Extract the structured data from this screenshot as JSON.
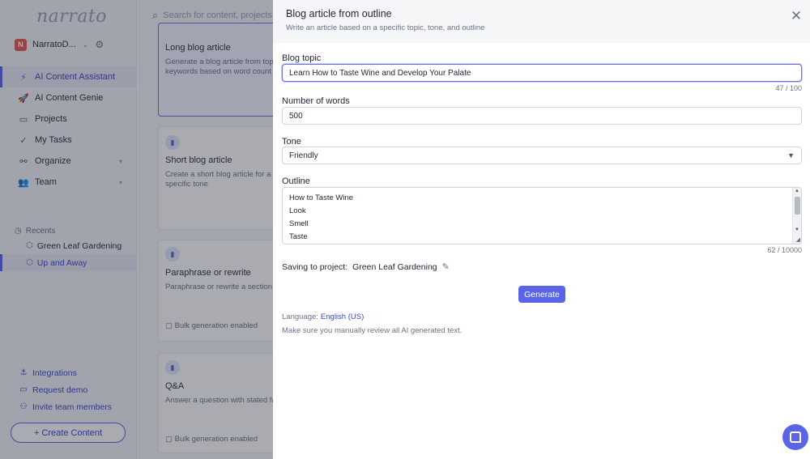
{
  "sidebar": {
    "logo": "narrato",
    "workspace": {
      "badge": "N",
      "name": "NarratoD..."
    },
    "nav": [
      {
        "label": "AI Content Assistant",
        "icon": "bolt-icon",
        "active": true
      },
      {
        "label": "AI Content Genie",
        "icon": "rocket-icon"
      },
      {
        "label": "Projects",
        "icon": "briefcase-icon"
      },
      {
        "label": "My Tasks",
        "icon": "check-icon"
      },
      {
        "label": "Organize",
        "icon": "organize-icon"
      },
      {
        "label": "Team",
        "icon": "team-icon"
      }
    ],
    "recents": {
      "heading": "Recents",
      "items": [
        {
          "label": "Green Leaf Gardening"
        },
        {
          "label": "Up and Away",
          "active": true
        }
      ]
    },
    "links": [
      {
        "label": "Integrations",
        "icon": "anchor-icon"
      },
      {
        "label": "Request demo",
        "icon": "monitor-icon"
      },
      {
        "label": "Invite team members",
        "icon": "user-plus-icon"
      }
    ],
    "create_button": "+ Create Content"
  },
  "main": {
    "search_placeholder": "Search for content, projects, a",
    "cards": [
      {
        "title": "Long blog article",
        "desc1": "Generate a blog article from topic",
        "desc2": "keywords based on word count a"
      },
      {
        "title": "Short blog article",
        "desc1": "Create a short blog article for a to",
        "desc2": "specific tone"
      },
      {
        "title": "Paraphrase or rewrite",
        "desc1": "Paraphrase or rewrite a section o",
        "bulk": "Bulk generation enabled"
      },
      {
        "title": "Q&A",
        "desc1": "Answer a question with stated fac",
        "bulk": "Bulk generation enabled"
      }
    ]
  },
  "drawer": {
    "title": "Blog article from outline",
    "subtitle": "Write an article based on a specific topic, tone, and outline",
    "topic": {
      "label": "Blog topic",
      "value": "Learn How to Taste Wine and Develop Your Palate",
      "counter": "47 / 100"
    },
    "words": {
      "label": "Number of words",
      "value": "500"
    },
    "tone": {
      "label": "Tone",
      "value": "Friendly"
    },
    "outline": {
      "label": "Outline",
      "lines": [
        "How to Taste Wine",
        "Look",
        "Smell",
        "Taste"
      ],
      "counter": "62 / 10000"
    },
    "saving": {
      "label": "Saving to project:",
      "project": "Green Leaf Gardening"
    },
    "generate_button": "Generate",
    "language": {
      "label": "Language:",
      "value": "English (US)"
    },
    "review_note": "Make sure you manually review all AI generated text."
  },
  "colors": {
    "accent": "#5b63e6",
    "overlay": "rgba(30,35,50,0.38)"
  }
}
